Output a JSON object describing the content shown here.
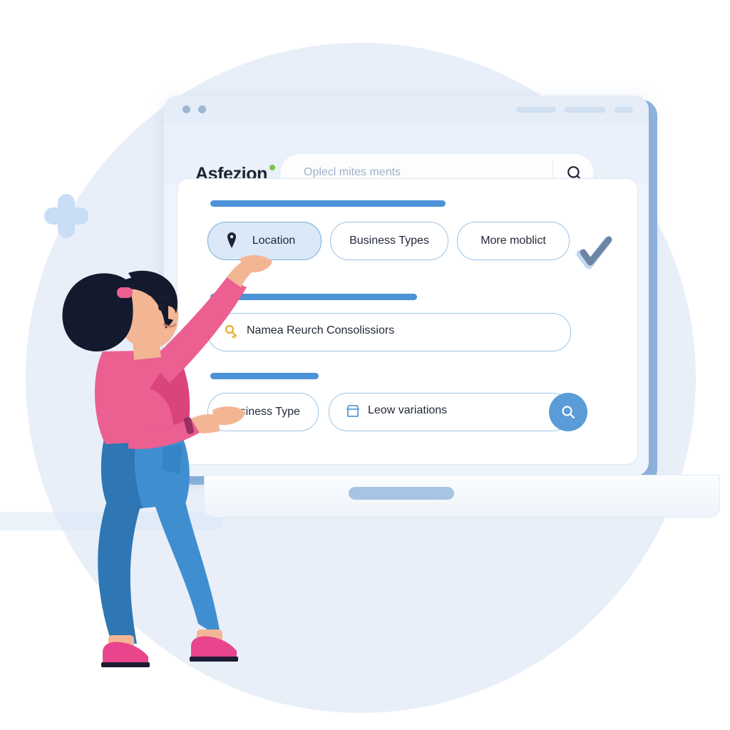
{
  "page": {
    "title": "Asfezion business search interface illustration",
    "background_color": "#ffffff",
    "accent_circle_color": "#e8eff9"
  },
  "browser_window": {
    "traffic_lights": [
      "dot-1",
      "dot-2"
    ],
    "tab_placeholders": [
      "pill-wide",
      "pill-wide-2",
      "pill-short"
    ]
  },
  "header": {
    "logo_text": "Asfezion",
    "logo_dot_color": "#79c44b",
    "search": {
      "placeholder": "Oplecl mites ments",
      "icon": "search-icon"
    }
  },
  "card": {
    "section_bars": [
      "bar-location",
      "bar-name",
      "bar-business"
    ],
    "filter_chips": [
      {
        "label": "Location",
        "icon": "map-pin-icon",
        "selected": true
      },
      {
        "label": "Business Types",
        "icon": "",
        "selected": false
      },
      {
        "label": "More moblict",
        "icon": "",
        "selected": false
      }
    ],
    "name_field": {
      "value": "Namea Reurch Consolissiors",
      "icon": "key-icon"
    },
    "business_chip": {
      "label": "Business Type",
      "selected": false
    },
    "variations_field": {
      "value": "Leow variations",
      "icon": "store-icon",
      "submit_icon": "search-icon",
      "submit_color": "#5a9cd8"
    },
    "checkmark": {
      "icon": "check-icon",
      "color": "#6c85a5"
    }
  },
  "illustration": {
    "person": "woman-pointing-at-screen",
    "hair_color": "#141a2e",
    "top_color": "#ec5f91",
    "jeans_color": "#3f8fd0",
    "shoe_color": "#e8458c",
    "skin_color": "#f3b695"
  },
  "decor": {
    "plus_shape": "plus-icon",
    "plus_color": "#c9ddf4"
  },
  "colors": {
    "accent_blue": "#4b92d6",
    "border_blue": "#9cc4e6",
    "chip_selected": "#dae8f7",
    "laptop_edge": "#8eb4de"
  }
}
